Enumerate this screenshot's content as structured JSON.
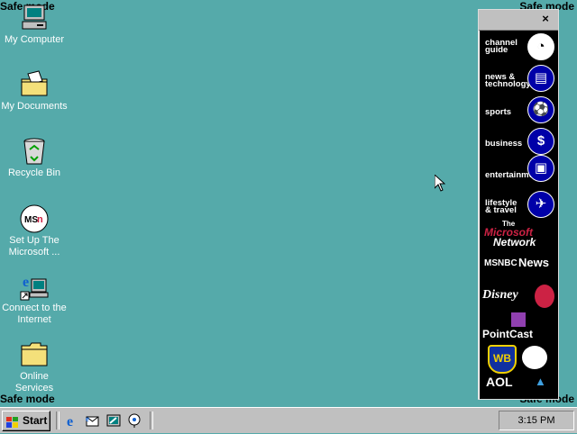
{
  "safe_mode": {
    "top_left": "Safe mode",
    "top_right": "Safe mode",
    "bottom_left": "Safe mode",
    "bottom_right": "Safe mode"
  },
  "desktop": {
    "my_computer": "My Computer",
    "my_documents": "My Documents",
    "recycle_bin": "Recycle Bin",
    "msn_line1": "Set Up The",
    "msn_line2": "Microsoft ...",
    "connect_line1": "Connect to the",
    "connect_line2": "Internet",
    "online_line1": "Online",
    "online_line2": "Services"
  },
  "channel_bar": {
    "close": "×",
    "channels": {
      "guide": [
        "channel",
        "guide"
      ],
      "news": [
        "news &",
        "technology"
      ],
      "sports": [
        "sports"
      ],
      "business": [
        "business"
      ],
      "entertainment": [
        "entertainment"
      ],
      "lifestyle": [
        "lifestyle",
        "& travel"
      ]
    },
    "logos": {
      "msn_the": "The",
      "msn_microsoft": "Microsoft",
      "msn_network": "Network",
      "msnbc": "MSNBC",
      "msnbc_news": "News",
      "disney": "Disney",
      "pointcast": "PointCast",
      "wb": "WB",
      "aol": "AOL"
    }
  },
  "taskbar": {
    "start": "Start",
    "clock": "3:15 PM"
  },
  "colors": {
    "desktop": "#55aaaa",
    "taskbar": "#c0c0c0",
    "channel_blue": "#0000a8",
    "msn_red": "#cc2244"
  }
}
